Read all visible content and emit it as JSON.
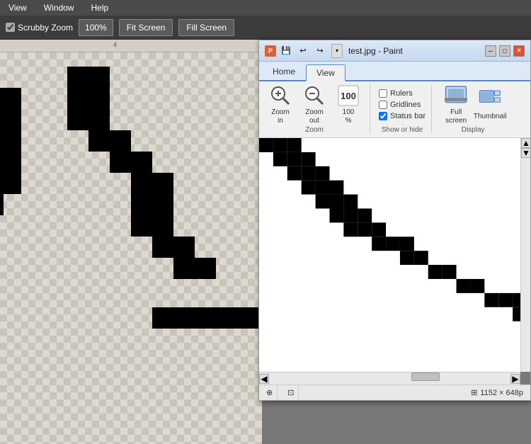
{
  "menubar": {
    "items": [
      "View",
      "Window",
      "Help"
    ]
  },
  "toolbar": {
    "scrubby_zoom_label": "Scrubby Zoom",
    "zoom_value": "100%",
    "fit_screen_label": "Fit Screen",
    "fill_screen_label": "Fill Screen",
    "scrubby_checked": true
  },
  "ruler": {
    "value": "4"
  },
  "paint_window": {
    "title": "test.jpg - Paint",
    "title_icon": "P",
    "tabs": [
      {
        "label": "Home",
        "active": false
      },
      {
        "label": "View",
        "active": true
      }
    ],
    "ribbon": {
      "groups": [
        {
          "name": "Zoom",
          "buttons": [
            {
              "label": "Zoom\nin",
              "icon": "zoom-in"
            },
            {
              "label": "Zoom\nout",
              "icon": "zoom-out"
            },
            {
              "label": "100\n%",
              "icon": "100-percent"
            }
          ]
        },
        {
          "name": "Show or hide",
          "checkboxes": [
            {
              "label": "Rulers",
              "checked": false
            },
            {
              "label": "Gridlines",
              "checked": false
            },
            {
              "label": "Status bar",
              "checked": true
            }
          ]
        },
        {
          "name": "Display",
          "buttons": [
            {
              "label": "Full\nscreen",
              "icon": "fullscreen"
            },
            {
              "label": "Thumbnail",
              "icon": "thumbnail"
            }
          ]
        }
      ]
    },
    "statusbar": {
      "position_icon": "⊕",
      "selection_icon": "⊡",
      "dimensions": "1152 × 648p"
    }
  },
  "quick_access": {
    "buttons": [
      "💾",
      "↩",
      "↪",
      "▼"
    ]
  },
  "colors": {
    "accent_blue": "#5b87c9",
    "toolbar_bg": "#3c3c3c",
    "menubar_bg": "#4a4a4a",
    "canvas_bg": "#787878",
    "ribbon_bg": "#f0f0f0",
    "titlebar_gradient_top": "#dce9f7",
    "titlebar_gradient_bottom": "#c5d9f0"
  }
}
